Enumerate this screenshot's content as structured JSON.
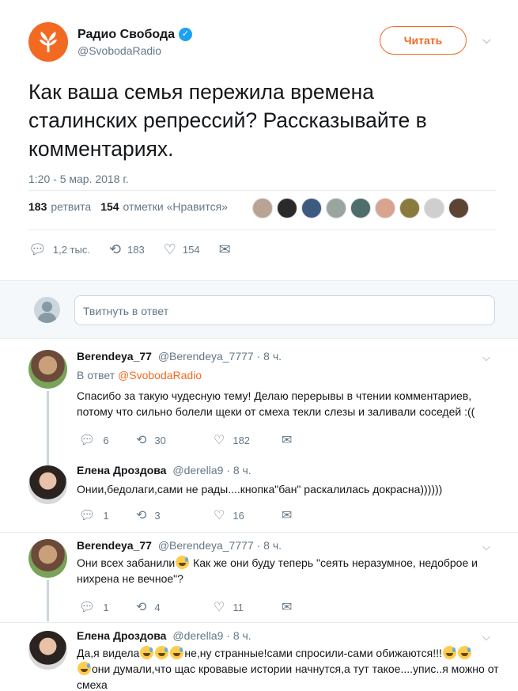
{
  "colors": {
    "accent": "#f26a22",
    "link": "#1da1f2",
    "muted": "#657786"
  },
  "tweet": {
    "author_name": "Радио Свобода",
    "author_handle": "@SvobodaRadio",
    "follow_label": "Читать",
    "text": "Как ваша семья пережила времена сталинских репрессий? Рассказывайте в комментариях.",
    "timestamp": "1:20 - 5 мар. 2018 г.",
    "retweets_count": "183",
    "retweets_label": "ретвита",
    "likes_count": "154",
    "likes_label": "отметки «Нравится»",
    "actions": {
      "replies": "1,2 тыс.",
      "retweets": "183",
      "likes": "154"
    }
  },
  "reply_box": {
    "placeholder": "Твитнуть в ответ"
  },
  "replies": [
    {
      "name": "Berendeya_77",
      "handle": "@Berendeya_7777",
      "time": "· 8 ч.",
      "reply_to_prefix": "В ответ",
      "reply_to_handle": "@SvobodaRadio",
      "text": "Спасибо за такую чудесную тему! Делаю перерывы в чтении комментариев, потому что сильно болели щеки от смеха текли слезы и заливали соседей :((",
      "replies": "6",
      "retweets": "30",
      "likes": "182"
    },
    {
      "name": "Елена Дроздова",
      "handle": "@derella9",
      "time": "· 8 ч.",
      "text": "Онии,бедолаги,сами не рады....кнопка\"бан\" раскалилась докрасна))))))",
      "replies": "1",
      "retweets": "3",
      "likes": "16"
    },
    {
      "name": "Berendeya_77",
      "handle": "@Berendeya_7777",
      "time": "· 8 ч.",
      "text_a": "Они всех забанили",
      "text_b": " Как же они буду теперь \"сеять неразумное, недоброе и нихрена не вечное\"?",
      "replies": "1",
      "retweets": "4",
      "likes": "11"
    },
    {
      "name": "Елена Дроздова",
      "handle": "@derella9",
      "time": "· 8 ч.",
      "text_a": "Да,я видела",
      "text_b": "не,ну странные!сами спросили-сами обижаются!!!",
      "text_c": "они думали,что щас кровавые истории начнутся,а тут такое....упис..я можно от смеха"
    }
  ]
}
